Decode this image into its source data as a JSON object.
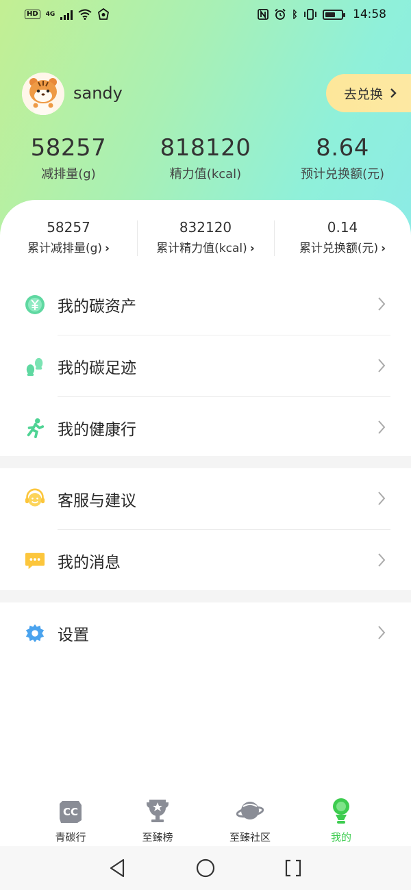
{
  "status_bar": {
    "left_badge": "HD",
    "network": "4G",
    "right_icons": [
      "nfc-icon",
      "alarm-icon",
      "bluetooth-icon",
      "vibrate-icon",
      "battery-icon"
    ],
    "time": "14:58"
  },
  "profile": {
    "username": "sandy",
    "exchange_label": "去兑换",
    "exchange_chevron": "›"
  },
  "stats_top": [
    {
      "value": "58257",
      "label": "减排量(g)"
    },
    {
      "value": "818120",
      "label": "精力值(kcal)"
    },
    {
      "value": "8.64",
      "label": "预计兑换额(元)"
    }
  ],
  "stats_cumulative": [
    {
      "value": "58257",
      "label": "累计减排量(g)"
    },
    {
      "value": "832120",
      "label": "累计精力值(kcal)"
    },
    {
      "value": "0.14",
      "label": "累计兑换额(元)"
    }
  ],
  "menu_group_1": [
    {
      "label": "我的碳资产",
      "icon": "yuan-coin-icon"
    },
    {
      "label": "我的碳足迹",
      "icon": "footprint-icon"
    },
    {
      "label": "我的健康行",
      "icon": "runner-icon"
    }
  ],
  "menu_group_2": [
    {
      "label": "客服与建议",
      "icon": "headset-icon"
    },
    {
      "label": "我的消息",
      "icon": "message-icon"
    }
  ],
  "menu_group_3": [
    {
      "label": "设置",
      "icon": "gear-icon"
    }
  ],
  "tabs": [
    {
      "label": "青碳行",
      "icon": "cc-icon",
      "active": false
    },
    {
      "label": "至臻榜",
      "icon": "trophy-icon",
      "active": false
    },
    {
      "label": "至臻社区",
      "icon": "planet-icon",
      "active": false
    },
    {
      "label": "我的",
      "icon": "person-icon",
      "active": true
    }
  ],
  "colors": {
    "accent_green": "#3dcc4f",
    "exchange_button": "#fde79a",
    "hero_gradient_start": "#c3ef93",
    "hero_gradient_end": "#8cebe6"
  }
}
